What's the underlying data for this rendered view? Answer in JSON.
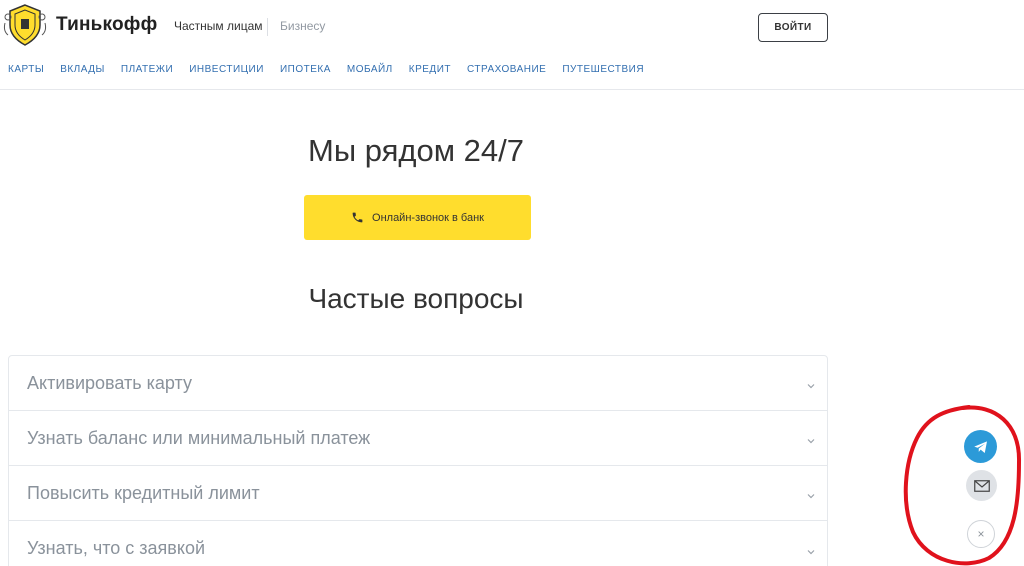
{
  "header": {
    "brand": "Тинькофф",
    "segments": {
      "personal": "Частным лицам",
      "business": "Бизнесу"
    },
    "login_label": "ВОЙТИ",
    "nav": [
      "Карты",
      "Вклады",
      "Платежи",
      "Инвестиции",
      "Ипотека",
      "Мобайл",
      "Кредит",
      "Страхование",
      "Путешествия"
    ]
  },
  "hero": {
    "title": "Мы рядом 24/7",
    "call_button": "Онлайн-звонок в банк"
  },
  "faq": {
    "title": "Частые вопросы",
    "items": [
      "Активировать карту",
      "Узнать баланс или минимальный платеж",
      "Повысить кредитный лимит",
      "Узнать, что с заявкой"
    ]
  },
  "widget": {
    "buttons": [
      "telegram-icon",
      "mail-icon",
      "close-icon"
    ],
    "close_symbol": "×"
  },
  "colors": {
    "accent_yellow": "#ffdd2d",
    "nav_link": "#336fb0",
    "telegram": "#2c9ad8",
    "annotation_red": "#e0121c"
  }
}
